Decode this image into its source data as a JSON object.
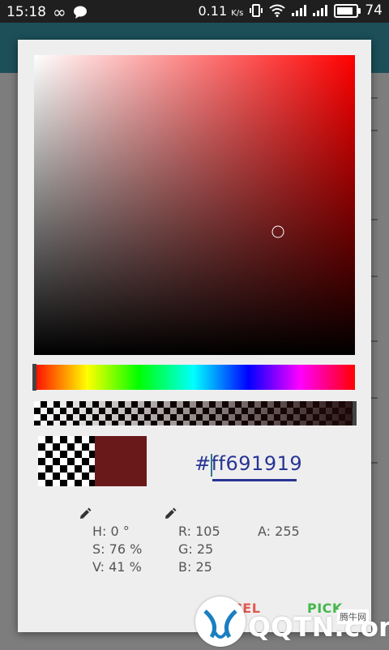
{
  "status_bar": {
    "time": "15:18",
    "speed": "0.11",
    "speed_unit": "K/s",
    "battery": "74"
  },
  "picker": {
    "hex_value": "#ff691919",
    "hue": "H: 0 °",
    "saturation": "S: 76 %",
    "value": "V: 41 %",
    "red": "R: 105",
    "green": "G: 25",
    "blue": "B: 25",
    "alpha": "A: 255",
    "current_color": "#691919",
    "sv_cursor_saturation": 0.76,
    "sv_cursor_value": 0.41
  },
  "buttons": {
    "cancel": "CANCEL",
    "pick": "PICK"
  },
  "watermark": {
    "text": "QQTN.com",
    "small": "腾牛网"
  },
  "colors": {
    "accent_text": "#283593",
    "cancel": "#e0584f",
    "pick": "#43b84a"
  }
}
